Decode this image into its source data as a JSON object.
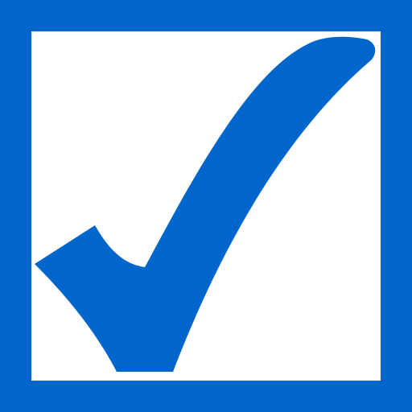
{
  "checkbox": {
    "checked": true,
    "icon": "check-icon",
    "color": "#0066CC",
    "background": "#FFFFFF"
  }
}
